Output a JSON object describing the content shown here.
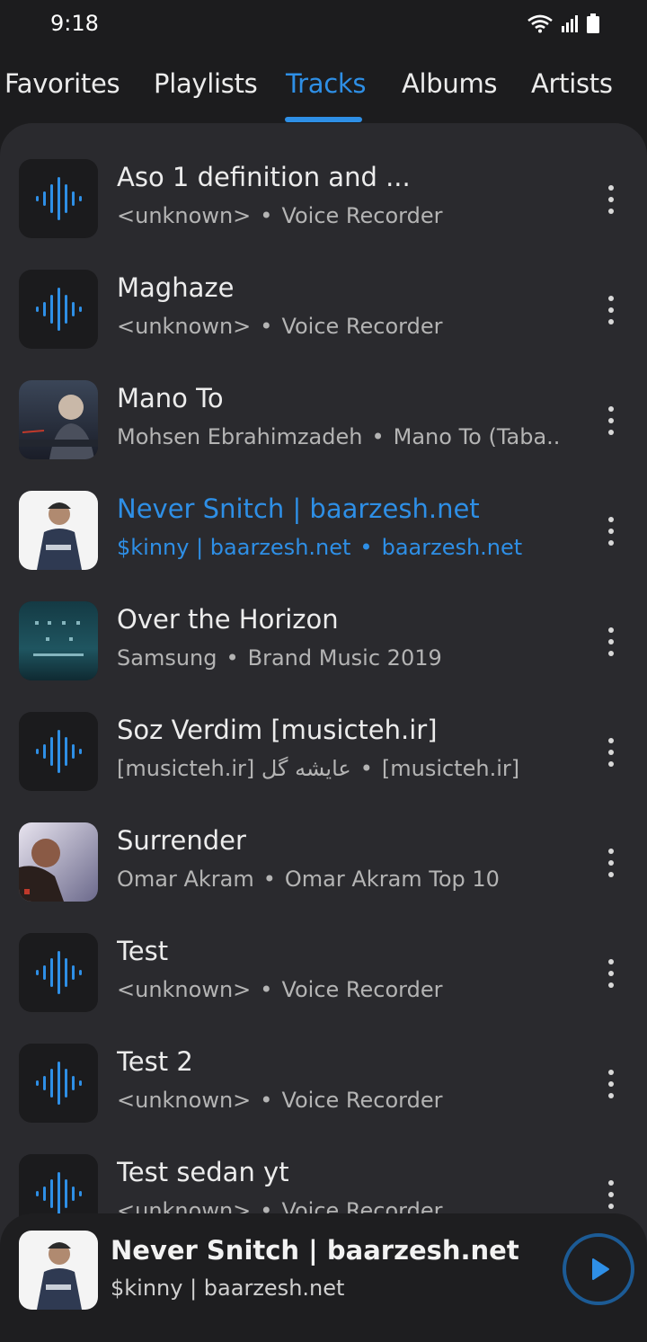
{
  "status": {
    "time": "9:18"
  },
  "tabs": [
    {
      "label": "Favorites",
      "active": false
    },
    {
      "label": "Playlists",
      "active": false
    },
    {
      "label": "Tracks",
      "active": true
    },
    {
      "label": "Albums",
      "active": false
    },
    {
      "label": "Artists",
      "active": false
    }
  ],
  "tracks": [
    {
      "title": "Aso 1 definition and ...",
      "artist": "<unknown>",
      "album": "Voice Recorder",
      "art": "waveform"
    },
    {
      "title": "Maghaze",
      "artist": "<unknown>",
      "album": "Voice Recorder",
      "art": "waveform"
    },
    {
      "title": "Mano To",
      "artist": "Mohsen Ebrahimzadeh",
      "album": "Mano To (Taba...",
      "art": "album-cover"
    },
    {
      "title": "Never Snitch | baarzesh.net",
      "artist": "$kinny | baarzesh.net",
      "album": "baarzesh.net",
      "art": "album-cover",
      "playing": true
    },
    {
      "title": "Over the Horizon",
      "artist": "Samsung",
      "album": "Brand Music 2019",
      "art": "album-cover"
    },
    {
      "title": "Soz Verdim [musicteh.ir]",
      "artist": "[musicteh.ir] عایشه گل",
      "album": "[musicteh.ir]",
      "art": "waveform"
    },
    {
      "title": "Surrender",
      "artist": "Omar Akram",
      "album": "Omar Akram Top 10",
      "art": "album-cover"
    },
    {
      "title": "Test",
      "artist": "<unknown>",
      "album": "Voice Recorder",
      "art": "waveform"
    },
    {
      "title": "Test 2",
      "artist": "<unknown>",
      "album": "Voice Recorder",
      "art": "waveform"
    },
    {
      "title": "Test sedan yt",
      "artist": "<unknown>",
      "album": "Voice Recorder",
      "art": "waveform"
    }
  ],
  "separator": "•",
  "mini_player": {
    "title": "Never Snitch | baarzesh.net",
    "artist": "$kinny | baarzesh.net"
  },
  "colors": {
    "accent": "#2e8fe6",
    "background": "#1c1c1e",
    "sheet": "#2a2a2e"
  }
}
